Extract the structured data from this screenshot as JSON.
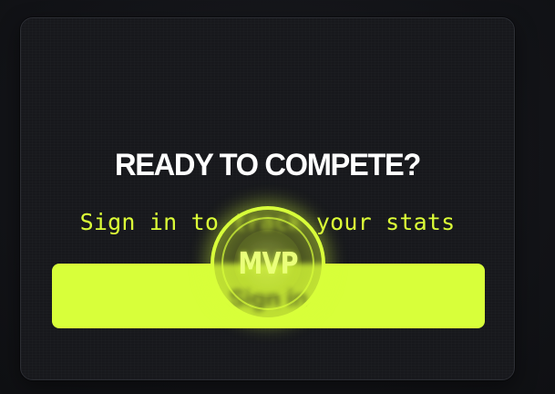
{
  "login_card": {
    "heading": "READY TO COMPETE?",
    "subtitle": "Sign in to track your stats",
    "button_label": "Sign in",
    "badge_label": "MVP"
  },
  "colors": {
    "page_background": "#111216",
    "card_background": "#17181c",
    "card_border": "#2c2e34",
    "accent": "#d8ff3a",
    "subtitle_text": "#dcff37",
    "heading_text": "#ffffff",
    "button_text": "#1a1b1f"
  },
  "icons": {
    "badge": "mvp-badge-icon"
  }
}
